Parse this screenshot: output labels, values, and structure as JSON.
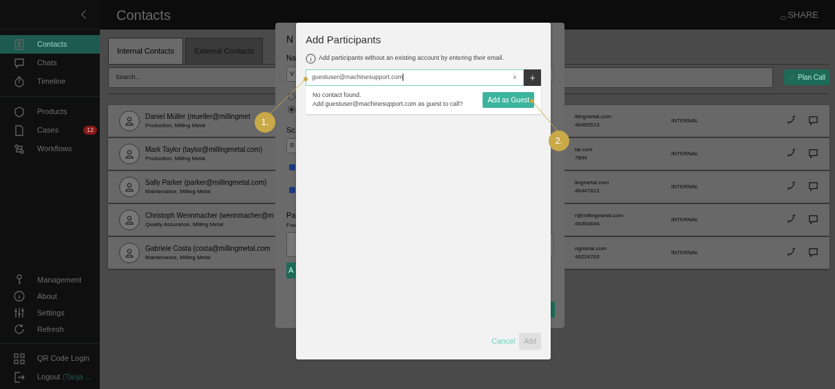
{
  "header": {
    "title": "Contacts",
    "logo": "SHARE"
  },
  "sidebar": {
    "main_items": [
      {
        "label": "Contacts",
        "selected": true
      },
      {
        "label": "Chats",
        "selected": false
      },
      {
        "label": "Timeline",
        "selected": false
      }
    ],
    "work_items": [
      {
        "label": "Products",
        "selected": false
      },
      {
        "label": "Cases",
        "selected": false,
        "badge": "12"
      },
      {
        "label": "Workflows",
        "selected": false
      }
    ],
    "footer_items": [
      {
        "label": "Management"
      },
      {
        "label": "About"
      },
      {
        "label": "Settings"
      },
      {
        "label": "Refresh"
      }
    ],
    "qr_login": "QR Code Login",
    "logout": {
      "label": "Logout",
      "user": "(Tanja ..."
    }
  },
  "tabs": [
    {
      "label": "Internal Contacts",
      "selected": true
    },
    {
      "label": "External Contacts",
      "selected": false
    }
  ],
  "search": {
    "placeholder": "Search..."
  },
  "plan_call_button": "Plan Call",
  "contacts": [
    {
      "name": "Daniel Müller (mueller@millingmet",
      "department": "Production, Milling Metal",
      "email": "illingmetal.com",
      "phone": "46465513",
      "type": "INTERNAL"
    },
    {
      "name": "Mark Taylor (taylor@millingmetal.com)",
      "department": "Production, Milling Metal",
      "email": "tal.com",
      "phone": "7894",
      "type": "INTERNAL"
    },
    {
      "name": "Sally Parker (parker@millingmetal.com)",
      "department": "Maintenance, Milling Metal",
      "email": "lingmetal.com",
      "phone": "46447812",
      "type": "INTERNAL"
    },
    {
      "name": "Christoph Wennmacher (wennmacher@m",
      "department": "Quality Assurance, Milling Metal",
      "email": "r@millingmetal.com",
      "phone": "46354694",
      "type": "INTERNAL"
    },
    {
      "name": "Gabriele Costa (costa@millingmetal.com",
      "department": "Maintenance, Milling Metal",
      "email": "ngmetal.com",
      "phone": "46224763",
      "type": "INTERNAL"
    }
  ],
  "background_dialog": {
    "title": "N",
    "name_label": "Na",
    "name_value": "V",
    "radios": [
      {
        "selected": false
      },
      {
        "selected": true
      }
    ],
    "schedule_label": "Sc",
    "schedule_value": "S",
    "checks": [
      {
        "checked": true
      },
      {
        "checked": true
      }
    ],
    "participants_label": "Pa",
    "participants_hint": "Fou",
    "add_button": "A"
  },
  "dialog": {
    "title": "Add Participants",
    "info": "Add participants without an existing account by entering their email.",
    "email_value": "guestuser@machinesupport.com",
    "clear": "x",
    "add_symbol": "+",
    "result_title": "No contact found.",
    "result_text": "Add guestuser@machinesupport.com as guest to call?",
    "guest_button": "Add as Guest",
    "cancel_button": "Cancel",
    "add_button": "Add",
    "add_disabled": true
  },
  "annotations": [
    "1.",
    "2."
  ]
}
